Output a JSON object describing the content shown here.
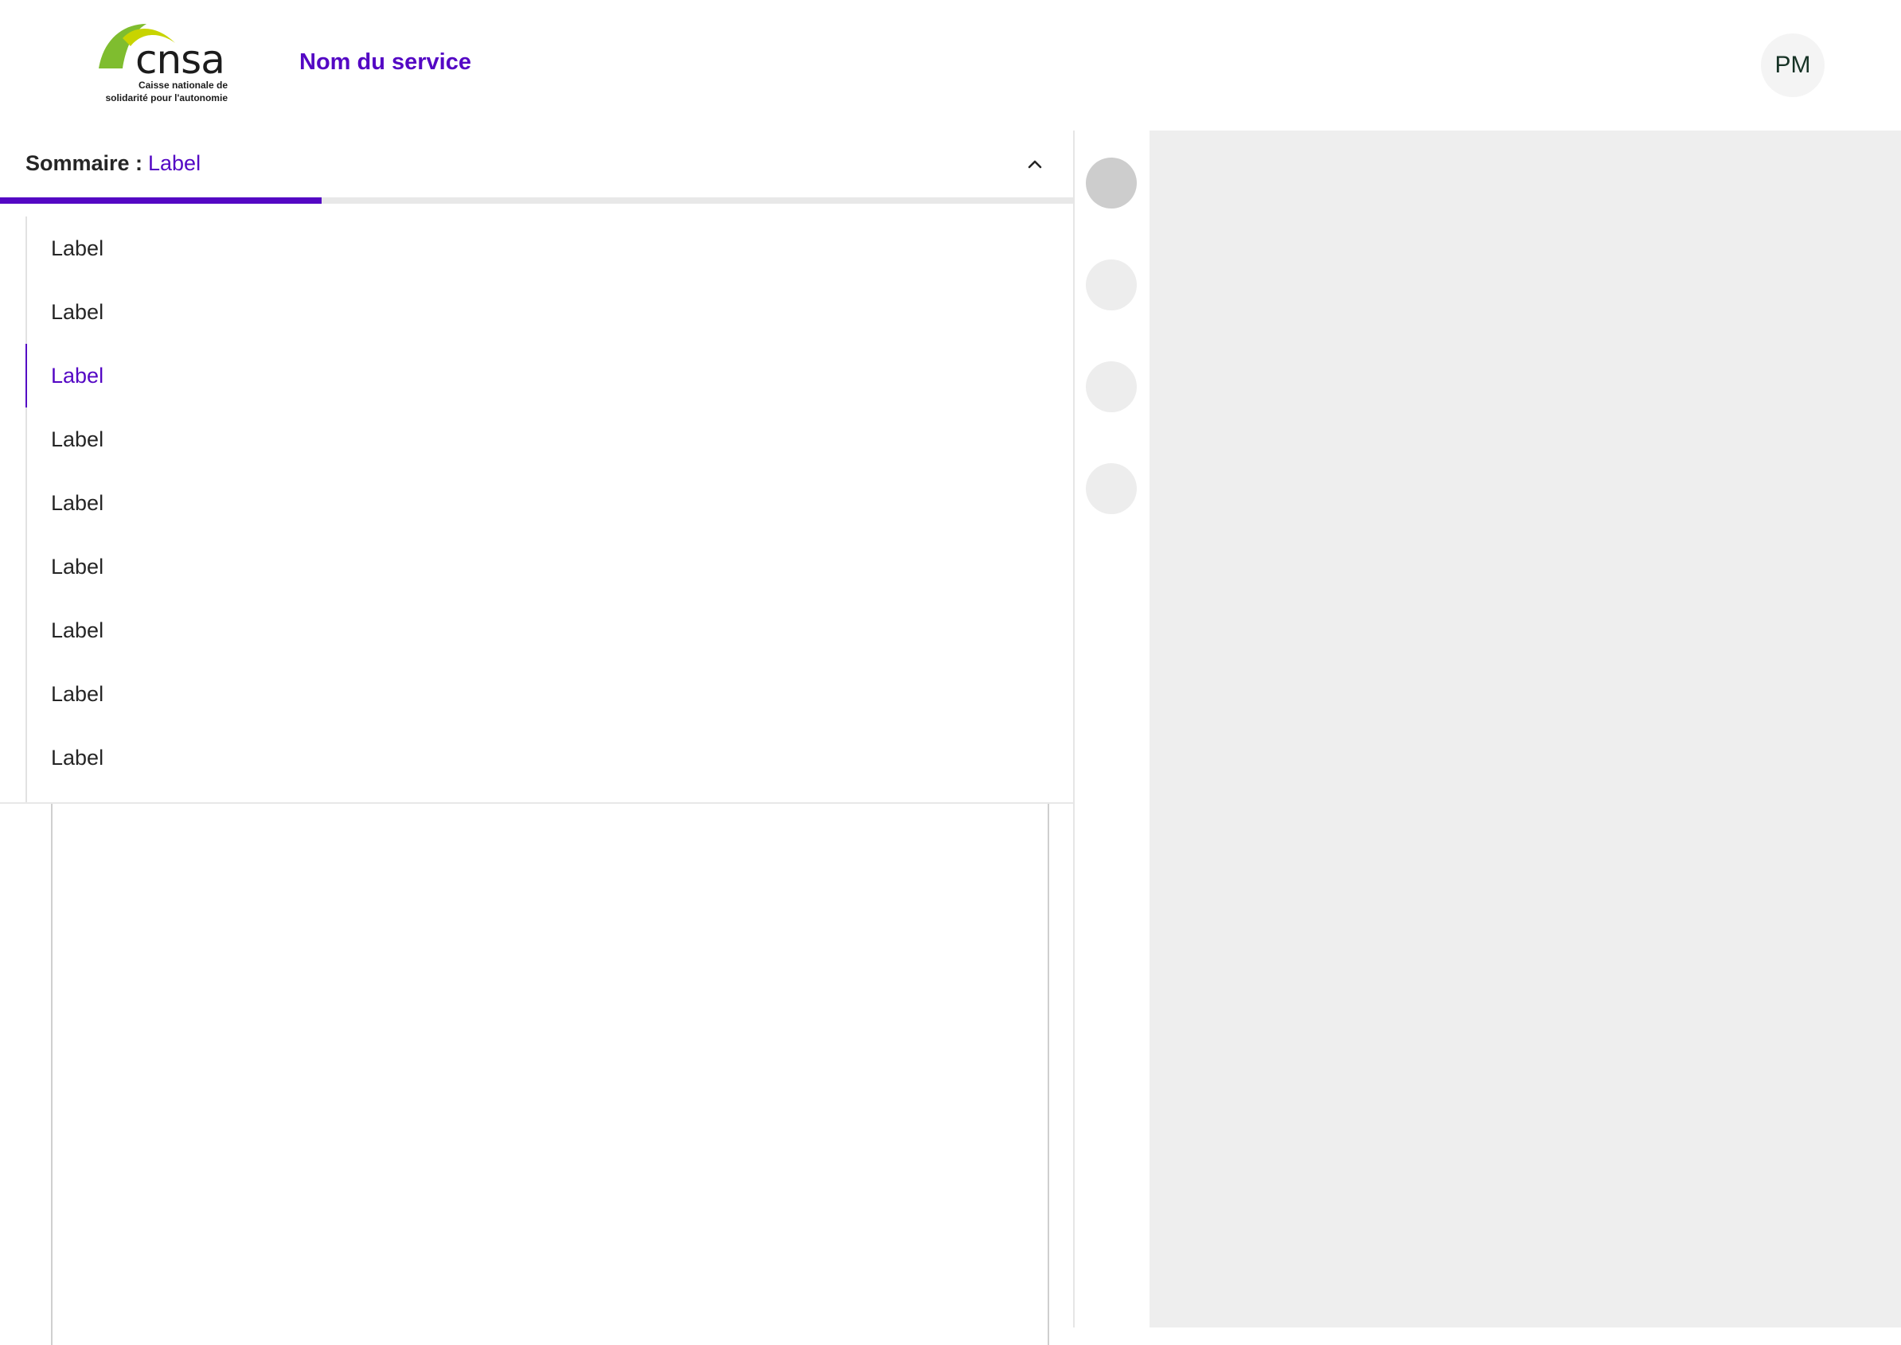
{
  "header": {
    "logo": {
      "name": "cnsa",
      "tagline_1": "Caisse nationale de",
      "tagline_2": "solidarité pour l'autonomie",
      "icon": "cnsa-arc-logo",
      "colors": [
        "#7fbd2f",
        "#c8d400"
      ]
    },
    "service_name": "Nom du service",
    "avatar_initials": "PM"
  },
  "summary": {
    "title": "Sommaire :",
    "current": "Label",
    "toggle_icon": "chevron-up-icon",
    "progress_fraction": 0.3,
    "items": [
      {
        "label": "Label",
        "active": false
      },
      {
        "label": "Label",
        "active": false
      },
      {
        "label": "Label",
        "active": true
      },
      {
        "label": "Label",
        "active": false
      },
      {
        "label": "Label",
        "active": false
      },
      {
        "label": "Label",
        "active": false
      },
      {
        "label": "Label",
        "active": false
      },
      {
        "label": "Label",
        "active": false
      },
      {
        "label": "Label",
        "active": false
      }
    ]
  },
  "rail": {
    "steps": [
      {
        "active": true
      },
      {
        "active": false
      },
      {
        "active": false
      },
      {
        "active": false
      }
    ]
  },
  "colors": {
    "accent": "#5407c4",
    "text": "#262626",
    "panel_bg": "#eeeeee"
  }
}
